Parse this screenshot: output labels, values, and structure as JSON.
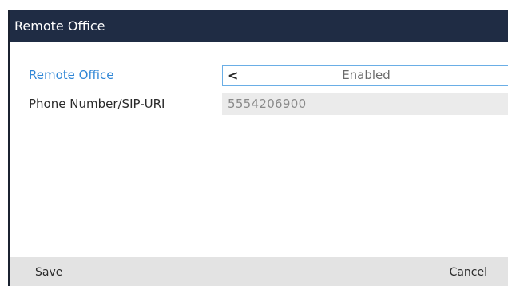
{
  "window": {
    "title": "Remote Office"
  },
  "fields": [
    {
      "label": "Remote Office",
      "value": "Enabled",
      "control": "selector",
      "focused": true
    },
    {
      "label": "Phone Number/SIP-URI",
      "value": "5554206900",
      "control": "text-readonly",
      "focused": false
    }
  ],
  "icons": {
    "selector_arrow": "chevron-left-icon",
    "selector_glyph": "<"
  },
  "softkeys": {
    "save_label": "Save",
    "cancel_label": "Cancel"
  },
  "colors": {
    "title_bar": "#1f2c44",
    "focused_label": "#2f86d6",
    "focus_border": "#6aaee6",
    "softkey_bar": "#e3e3e3"
  }
}
